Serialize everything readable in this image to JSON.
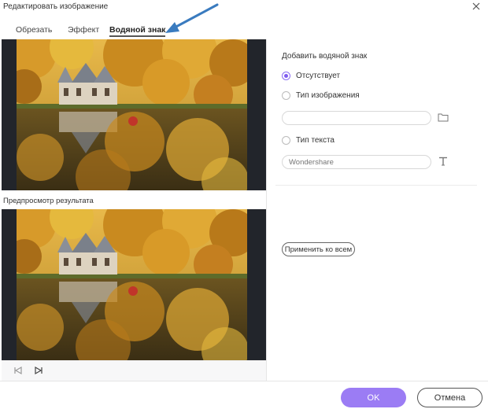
{
  "window": {
    "title": "Редактировать изображение",
    "close_icon": "close-icon"
  },
  "tabs": [
    {
      "label": "Обрезать",
      "active": false
    },
    {
      "label": "Эффект",
      "active": false
    },
    {
      "label": "Водяной знак",
      "active": true
    }
  ],
  "preview": {
    "result_label": "Предпросмотр результата"
  },
  "watermark": {
    "section_title": "Добавить водяной знак",
    "options": [
      {
        "label": "Отсутствует",
        "checked": true
      },
      {
        "label": "Тип изображения",
        "checked": false
      },
      {
        "label": "Тип текста",
        "checked": false
      }
    ],
    "image_path_value": "",
    "text_placeholder": "Wondershare",
    "apply_all_label": "Применить ко всем"
  },
  "footer": {
    "ok_label": "OK",
    "cancel_label": "Отмена"
  },
  "colors": {
    "accent": "#9b7cf4",
    "annotation_arrow": "#3a7bbf"
  }
}
